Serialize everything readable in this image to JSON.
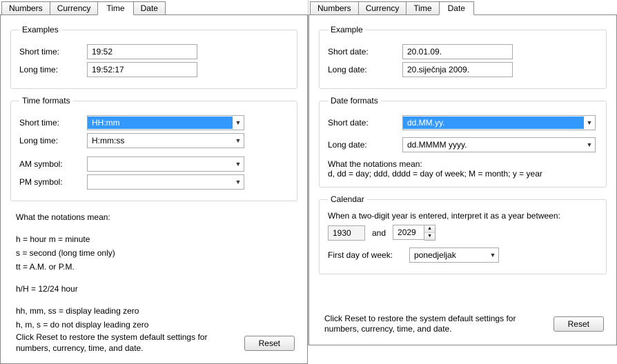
{
  "left": {
    "tabs": [
      "Numbers",
      "Currency",
      "Time",
      "Date"
    ],
    "activeTab": "Time",
    "examples": {
      "legend": "Examples",
      "shortLabel": "Short time:",
      "shortVal": "19:52",
      "longLabel": "Long time:",
      "longVal": "19:52:17"
    },
    "formats": {
      "legend": "Time formats",
      "shortLabel": "Short time:",
      "shortVal": "HH:mm",
      "longLabel": "Long time:",
      "longVal": "H:mm:ss",
      "amLabel": "AM symbol:",
      "amVal": "",
      "pmLabel": "PM symbol:",
      "pmVal": ""
    },
    "notation": {
      "title": "What the notations mean:",
      "l1": "h = hour   m = minute",
      "l2": "s = second (long time only)",
      "l3": "tt = A.M. or P.M.",
      "l4": "h/H = 12/24 hour",
      "l5": "hh, mm, ss = display leading zero",
      "l6": "h, m, s = do not display leading zero"
    },
    "footerMsg": "Click Reset to restore the system default settings for numbers, currency, time, and date.",
    "resetLabel": "Reset"
  },
  "right": {
    "tabs": [
      "Numbers",
      "Currency",
      "Time",
      "Date"
    ],
    "activeTab": "Date",
    "example": {
      "legend": "Example",
      "shortLabel": "Short date:",
      "shortVal": "20.01.09.",
      "longLabel": "Long date:",
      "longVal": "20.siječnja 2009."
    },
    "formats": {
      "legend": "Date formats",
      "shortLabel": "Short date:",
      "shortVal": "dd.MM.yy.",
      "longLabel": "Long date:",
      "longVal": "dd.MMMM yyyy.",
      "notTitle": "What the notations mean:",
      "notLine": "d, dd = day;  ddd, dddd = day of week;  M = month;  y = year"
    },
    "calendar": {
      "legend": "Calendar",
      "twoDigit": "When a two-digit year is entered, interpret it as a year between:",
      "yearFrom": "1930",
      "andLabel": "and",
      "yearTo": "2029",
      "firstDayLabel": "First day of week:",
      "firstDayVal": "ponedjeljak"
    },
    "footerMsg": "Click Reset to restore the system default settings for numbers, currency, time, and date.",
    "resetLabel": "Reset"
  }
}
